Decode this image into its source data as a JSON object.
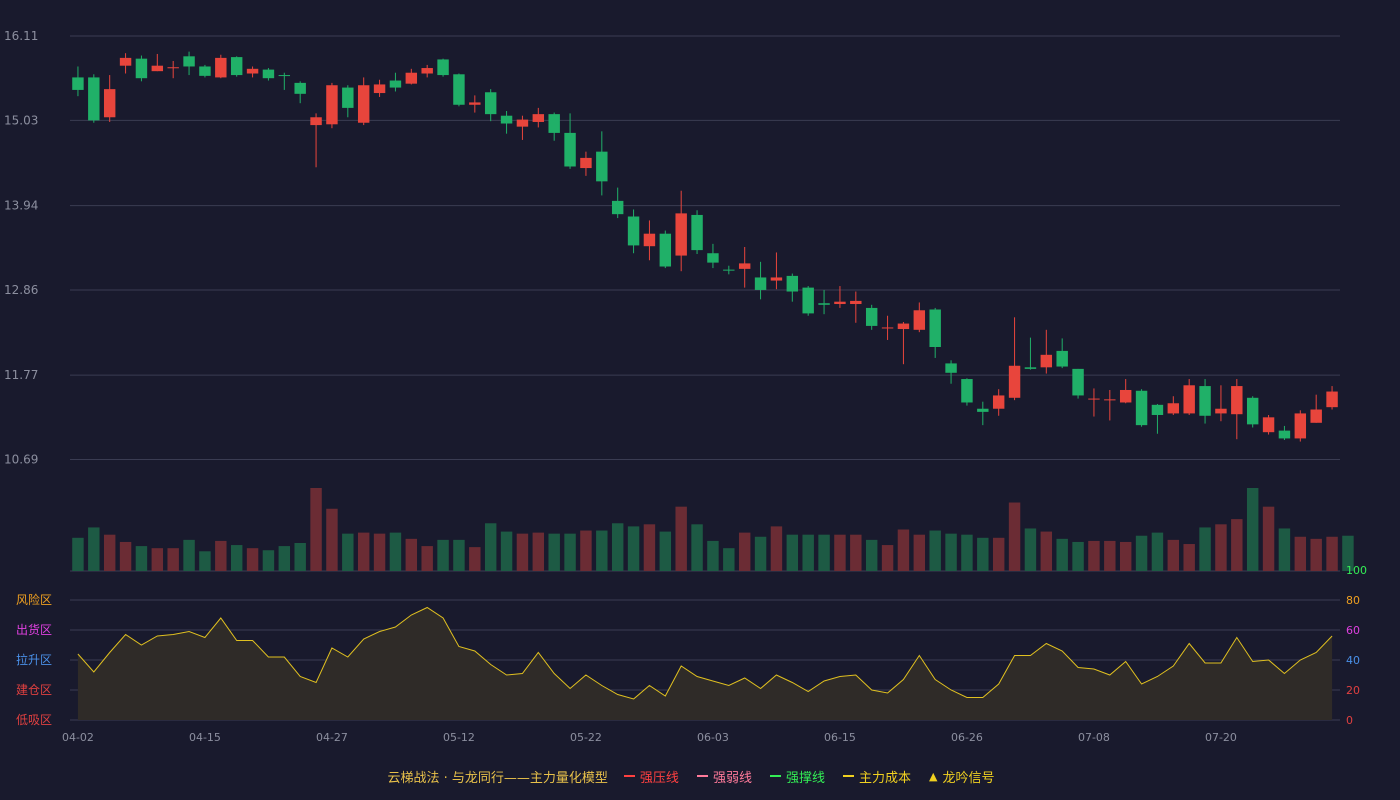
{
  "colors": {
    "background": "#191a2d",
    "up": "#e8453c",
    "down": "#20b068",
    "up_volume": "#6b2c34",
    "down_volume": "#1d5a44",
    "grid": "#3a3c52",
    "axis_text": "#8c8f9f",
    "indicator_line": "#e0c020",
    "indicator_fill": "#2f2b28"
  },
  "legend": {
    "title": "云梯战法 · 与龙同行——主力量化模型",
    "items": [
      {
        "label": "强压线",
        "color": "#ff4040",
        "style": "solid"
      },
      {
        "label": "强弱线",
        "color": "#ff7a9a",
        "style": "dashed"
      },
      {
        "label": "强撑线",
        "color": "#33ee55",
        "style": "solid"
      },
      {
        "label": "主力成本",
        "color": "#f0d020",
        "style": "dashed"
      },
      {
        "label": "龙吟信号",
        "color": "#f0d020",
        "style": "triangle"
      }
    ]
  },
  "chart_data": [
    {
      "type": "candlestick",
      "ylim": [
        10.3,
        16.11
      ],
      "y_ticks": [
        "16.11",
        "15.03",
        "13.94",
        "12.86",
        "11.77",
        "10.69"
      ],
      "x_ticks": [
        {
          "index": 0,
          "label": "04-02"
        },
        {
          "index": 8,
          "label": "04-15"
        },
        {
          "index": 16,
          "label": "04-27"
        },
        {
          "index": 24,
          "label": "05-12"
        },
        {
          "index": 32,
          "label": "05-22"
        },
        {
          "index": 40,
          "label": "06-03"
        },
        {
          "index": 48,
          "label": "06-15"
        },
        {
          "index": 56,
          "label": "06-26"
        },
        {
          "index": 64,
          "label": "07-08"
        },
        {
          "index": 72,
          "label": "07-20"
        }
      ],
      "candles": [
        [
          15.58,
          15.42,
          15.72,
          15.34
        ],
        [
          15.58,
          15.03,
          15.62,
          15.0
        ],
        [
          15.07,
          15.43,
          15.61,
          15.01
        ],
        [
          15.73,
          15.83,
          15.89,
          15.63
        ],
        [
          15.82,
          15.57,
          15.86,
          15.53
        ],
        [
          15.66,
          15.73,
          15.88,
          15.66
        ],
        [
          15.7,
          15.71,
          15.79,
          15.57
        ],
        [
          15.85,
          15.72,
          15.91,
          15.61
        ],
        [
          15.72,
          15.6,
          15.74,
          15.58
        ],
        [
          15.58,
          15.83,
          15.87,
          15.57
        ],
        [
          15.84,
          15.61,
          15.85,
          15.59
        ],
        [
          15.63,
          15.69,
          15.72,
          15.58
        ],
        [
          15.68,
          15.57,
          15.7,
          15.54
        ],
        [
          15.61,
          15.6,
          15.64,
          15.42
        ],
        [
          15.51,
          15.37,
          15.53,
          15.25
        ],
        [
          14.97,
          15.07,
          15.12,
          14.43
        ],
        [
          14.98,
          15.48,
          15.51,
          14.93
        ],
        [
          15.45,
          15.19,
          15.48,
          15.07
        ],
        [
          15.0,
          15.48,
          15.58,
          14.97
        ],
        [
          15.38,
          15.49,
          15.55,
          15.33
        ],
        [
          15.54,
          15.45,
          15.64,
          15.4
        ],
        [
          15.5,
          15.64,
          15.69,
          15.49
        ],
        [
          15.63,
          15.7,
          15.74,
          15.58
        ],
        [
          15.81,
          15.61,
          15.82,
          15.59
        ],
        [
          15.62,
          15.23,
          15.63,
          15.21
        ],
        [
          15.23,
          15.26,
          15.35,
          15.13
        ],
        [
          15.39,
          15.11,
          15.43,
          15.02
        ],
        [
          15.09,
          14.99,
          15.15,
          14.86
        ],
        [
          14.95,
          15.04,
          15.09,
          14.78
        ],
        [
          15.01,
          15.11,
          15.19,
          14.94
        ],
        [
          15.11,
          14.87,
          15.13,
          14.77
        ],
        [
          14.87,
          14.44,
          15.12,
          14.41
        ],
        [
          14.42,
          14.55,
          14.63,
          14.32
        ],
        [
          14.63,
          14.25,
          14.89,
          14.07
        ],
        [
          14.0,
          13.83,
          14.17,
          13.78
        ],
        [
          13.8,
          13.43,
          13.89,
          13.33
        ],
        [
          13.42,
          13.58,
          13.75,
          13.24
        ],
        [
          13.58,
          13.16,
          13.62,
          13.14
        ],
        [
          13.3,
          13.84,
          14.13,
          13.1
        ],
        [
          13.82,
          13.37,
          13.88,
          13.32
        ],
        [
          13.33,
          13.21,
          13.45,
          13.14
        ],
        [
          13.12,
          13.11,
          13.17,
          13.06
        ],
        [
          13.13,
          13.2,
          13.41,
          12.89
        ],
        [
          13.02,
          12.86,
          13.22,
          12.74
        ],
        [
          12.98,
          13.02,
          13.34,
          12.87
        ],
        [
          13.04,
          12.84,
          13.07,
          12.71
        ],
        [
          12.89,
          12.56,
          12.91,
          12.53
        ],
        [
          12.69,
          12.67,
          12.86,
          12.55
        ],
        [
          12.68,
          12.71,
          12.91,
          12.63
        ],
        [
          12.68,
          12.72,
          12.84,
          12.44
        ],
        [
          12.63,
          12.4,
          12.67,
          12.35
        ],
        [
          12.38,
          12.38,
          12.53,
          12.22
        ],
        [
          12.36,
          12.43,
          12.45,
          11.91
        ],
        [
          12.35,
          12.6,
          12.7,
          12.32
        ],
        [
          12.61,
          12.13,
          12.63,
          11.99
        ],
        [
          11.92,
          11.8,
          11.96,
          11.66
        ],
        [
          11.72,
          11.42,
          11.73,
          11.38
        ],
        [
          11.34,
          11.3,
          11.43,
          11.13
        ],
        [
          11.34,
          11.51,
          11.59,
          11.25
        ],
        [
          11.48,
          11.89,
          12.51,
          11.45
        ],
        [
          11.87,
          11.85,
          12.25,
          11.84
        ],
        [
          11.87,
          12.03,
          12.35,
          11.79
        ],
        [
          12.08,
          11.88,
          12.24,
          11.86
        ],
        [
          11.85,
          11.51,
          11.85,
          11.47
        ],
        [
          11.47,
          11.47,
          11.6,
          11.24
        ],
        [
          11.45,
          11.46,
          11.58,
          11.19
        ],
        [
          11.42,
          11.58,
          11.72,
          11.41
        ],
        [
          11.57,
          11.13,
          11.59,
          11.11
        ],
        [
          11.39,
          11.26,
          11.4,
          11.02
        ],
        [
          11.28,
          11.41,
          11.5,
          11.26
        ],
        [
          11.28,
          11.64,
          11.72,
          11.26
        ],
        [
          11.63,
          11.25,
          11.72,
          11.15
        ],
        [
          11.28,
          11.34,
          11.64,
          11.18
        ],
        [
          11.27,
          11.63,
          11.72,
          10.95
        ],
        [
          11.48,
          11.14,
          11.5,
          11.1
        ],
        [
          11.04,
          11.23,
          11.26,
          11.01
        ],
        [
          11.06,
          10.96,
          11.12,
          10.94
        ],
        [
          10.96,
          11.28,
          11.32,
          10.92
        ],
        [
          11.16,
          11.33,
          11.52,
          11.16
        ],
        [
          11.36,
          11.56,
          11.63,
          11.33
        ]
      ]
    },
    {
      "type": "bar",
      "name": "volume",
      "values": [
        32,
        42,
        35,
        28,
        24,
        22,
        22,
        30,
        19,
        29,
        25,
        22,
        20,
        24,
        27,
        80,
        60,
        36,
        37,
        36,
        37,
        31,
        24,
        30,
        30,
        23,
        46,
        38,
        36,
        37,
        36,
        36,
        39,
        39,
        46,
        43,
        45,
        38,
        62,
        45,
        29,
        22,
        37,
        33,
        43,
        35,
        35,
        35,
        35,
        35,
        30,
        25,
        40,
        35,
        39,
        36,
        35,
        32,
        32,
        66,
        41,
        38,
        31,
        28,
        29,
        29,
        28,
        34,
        37,
        30,
        26,
        42,
        45,
        50,
        80,
        62,
        41,
        33,
        31,
        33,
        34
      ]
    },
    {
      "type": "area",
      "name": "indicator",
      "ylim": [
        0,
        100
      ],
      "y_ticks": [
        "100",
        "80",
        "60",
        "40",
        "20",
        "0"
      ],
      "zone_labels": [
        {
          "label": "风险区",
          "color": "#f0a020"
        },
        {
          "label": "出货区",
          "color": "#e040e0"
        },
        {
          "label": "拉升区",
          "color": "#4a90e8"
        },
        {
          "label": "建仓区",
          "color": "#e04040"
        },
        {
          "label": "低吸区",
          "color": "#e04040"
        }
      ],
      "values": [
        44,
        32,
        45,
        57,
        50,
        56,
        57,
        59,
        55,
        68,
        53,
        53,
        42,
        42,
        29,
        25,
        48,
        42,
        54,
        59,
        62,
        70,
        75,
        68,
        49,
        46,
        37,
        30,
        31,
        45,
        31,
        21,
        30,
        23,
        17,
        14,
        23,
        16,
        36,
        29,
        26,
        23,
        28,
        21,
        30,
        25,
        19,
        26,
        29,
        30,
        20,
        18,
        27,
        43,
        27,
        20,
        15,
        15,
        24,
        43,
        43,
        51,
        46,
        35,
        34,
        30,
        39,
        24,
        29,
        36,
        51,
        38,
        38,
        55,
        39,
        40,
        31,
        40,
        45,
        56
      ]
    }
  ]
}
